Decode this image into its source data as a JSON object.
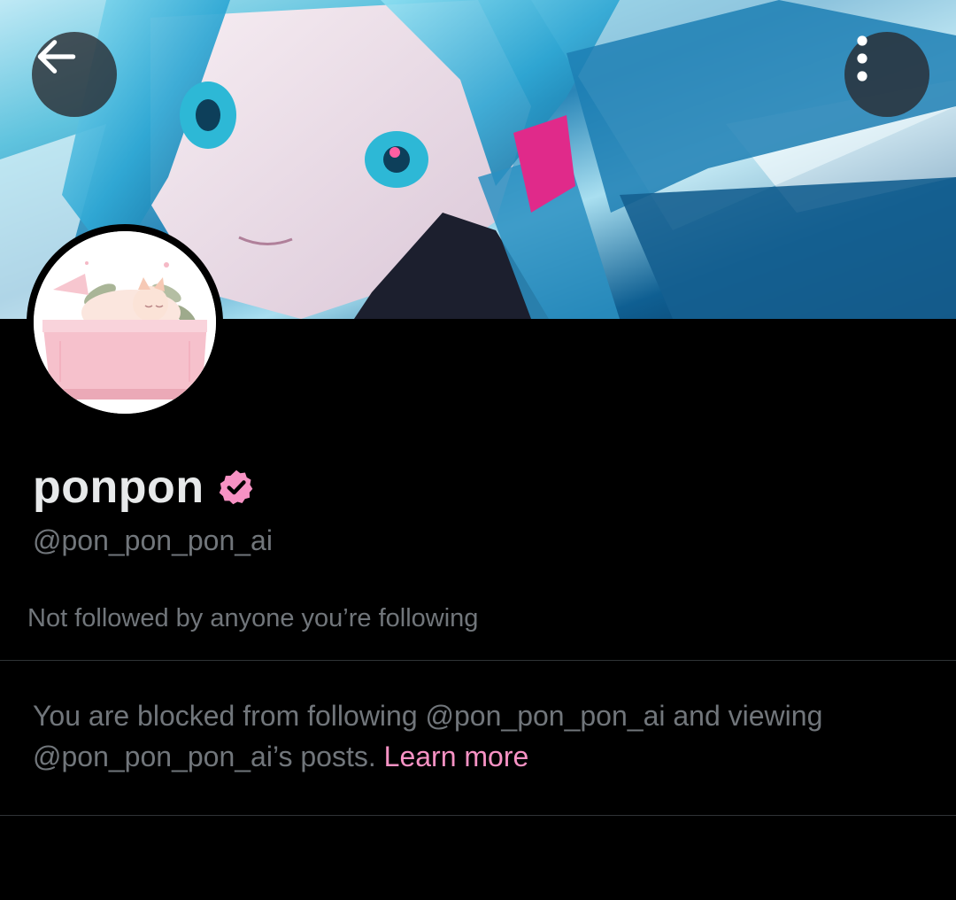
{
  "header": {
    "back_icon": "arrow-left-icon",
    "more_icon": "more-vertical-icon"
  },
  "profile": {
    "display_name": "ponpon",
    "verified_icon": "verified-badge-icon",
    "handle": "@pon_pon_pon_ai",
    "followed_note": "Not followed by anyone you’re following"
  },
  "blocked": {
    "message_prefix": "You are blocked from following @pon_pon_pon_ai and viewing @pon_pon_pon_ai’s posts.",
    "learn_more_label": "Learn more"
  },
  "colors": {
    "background": "#000000",
    "primary_text": "#e7e9ea",
    "secondary_text": "#71767b",
    "accent": "#f792c4",
    "verified_badge": "#f792c4",
    "divider": "#2f3336"
  }
}
